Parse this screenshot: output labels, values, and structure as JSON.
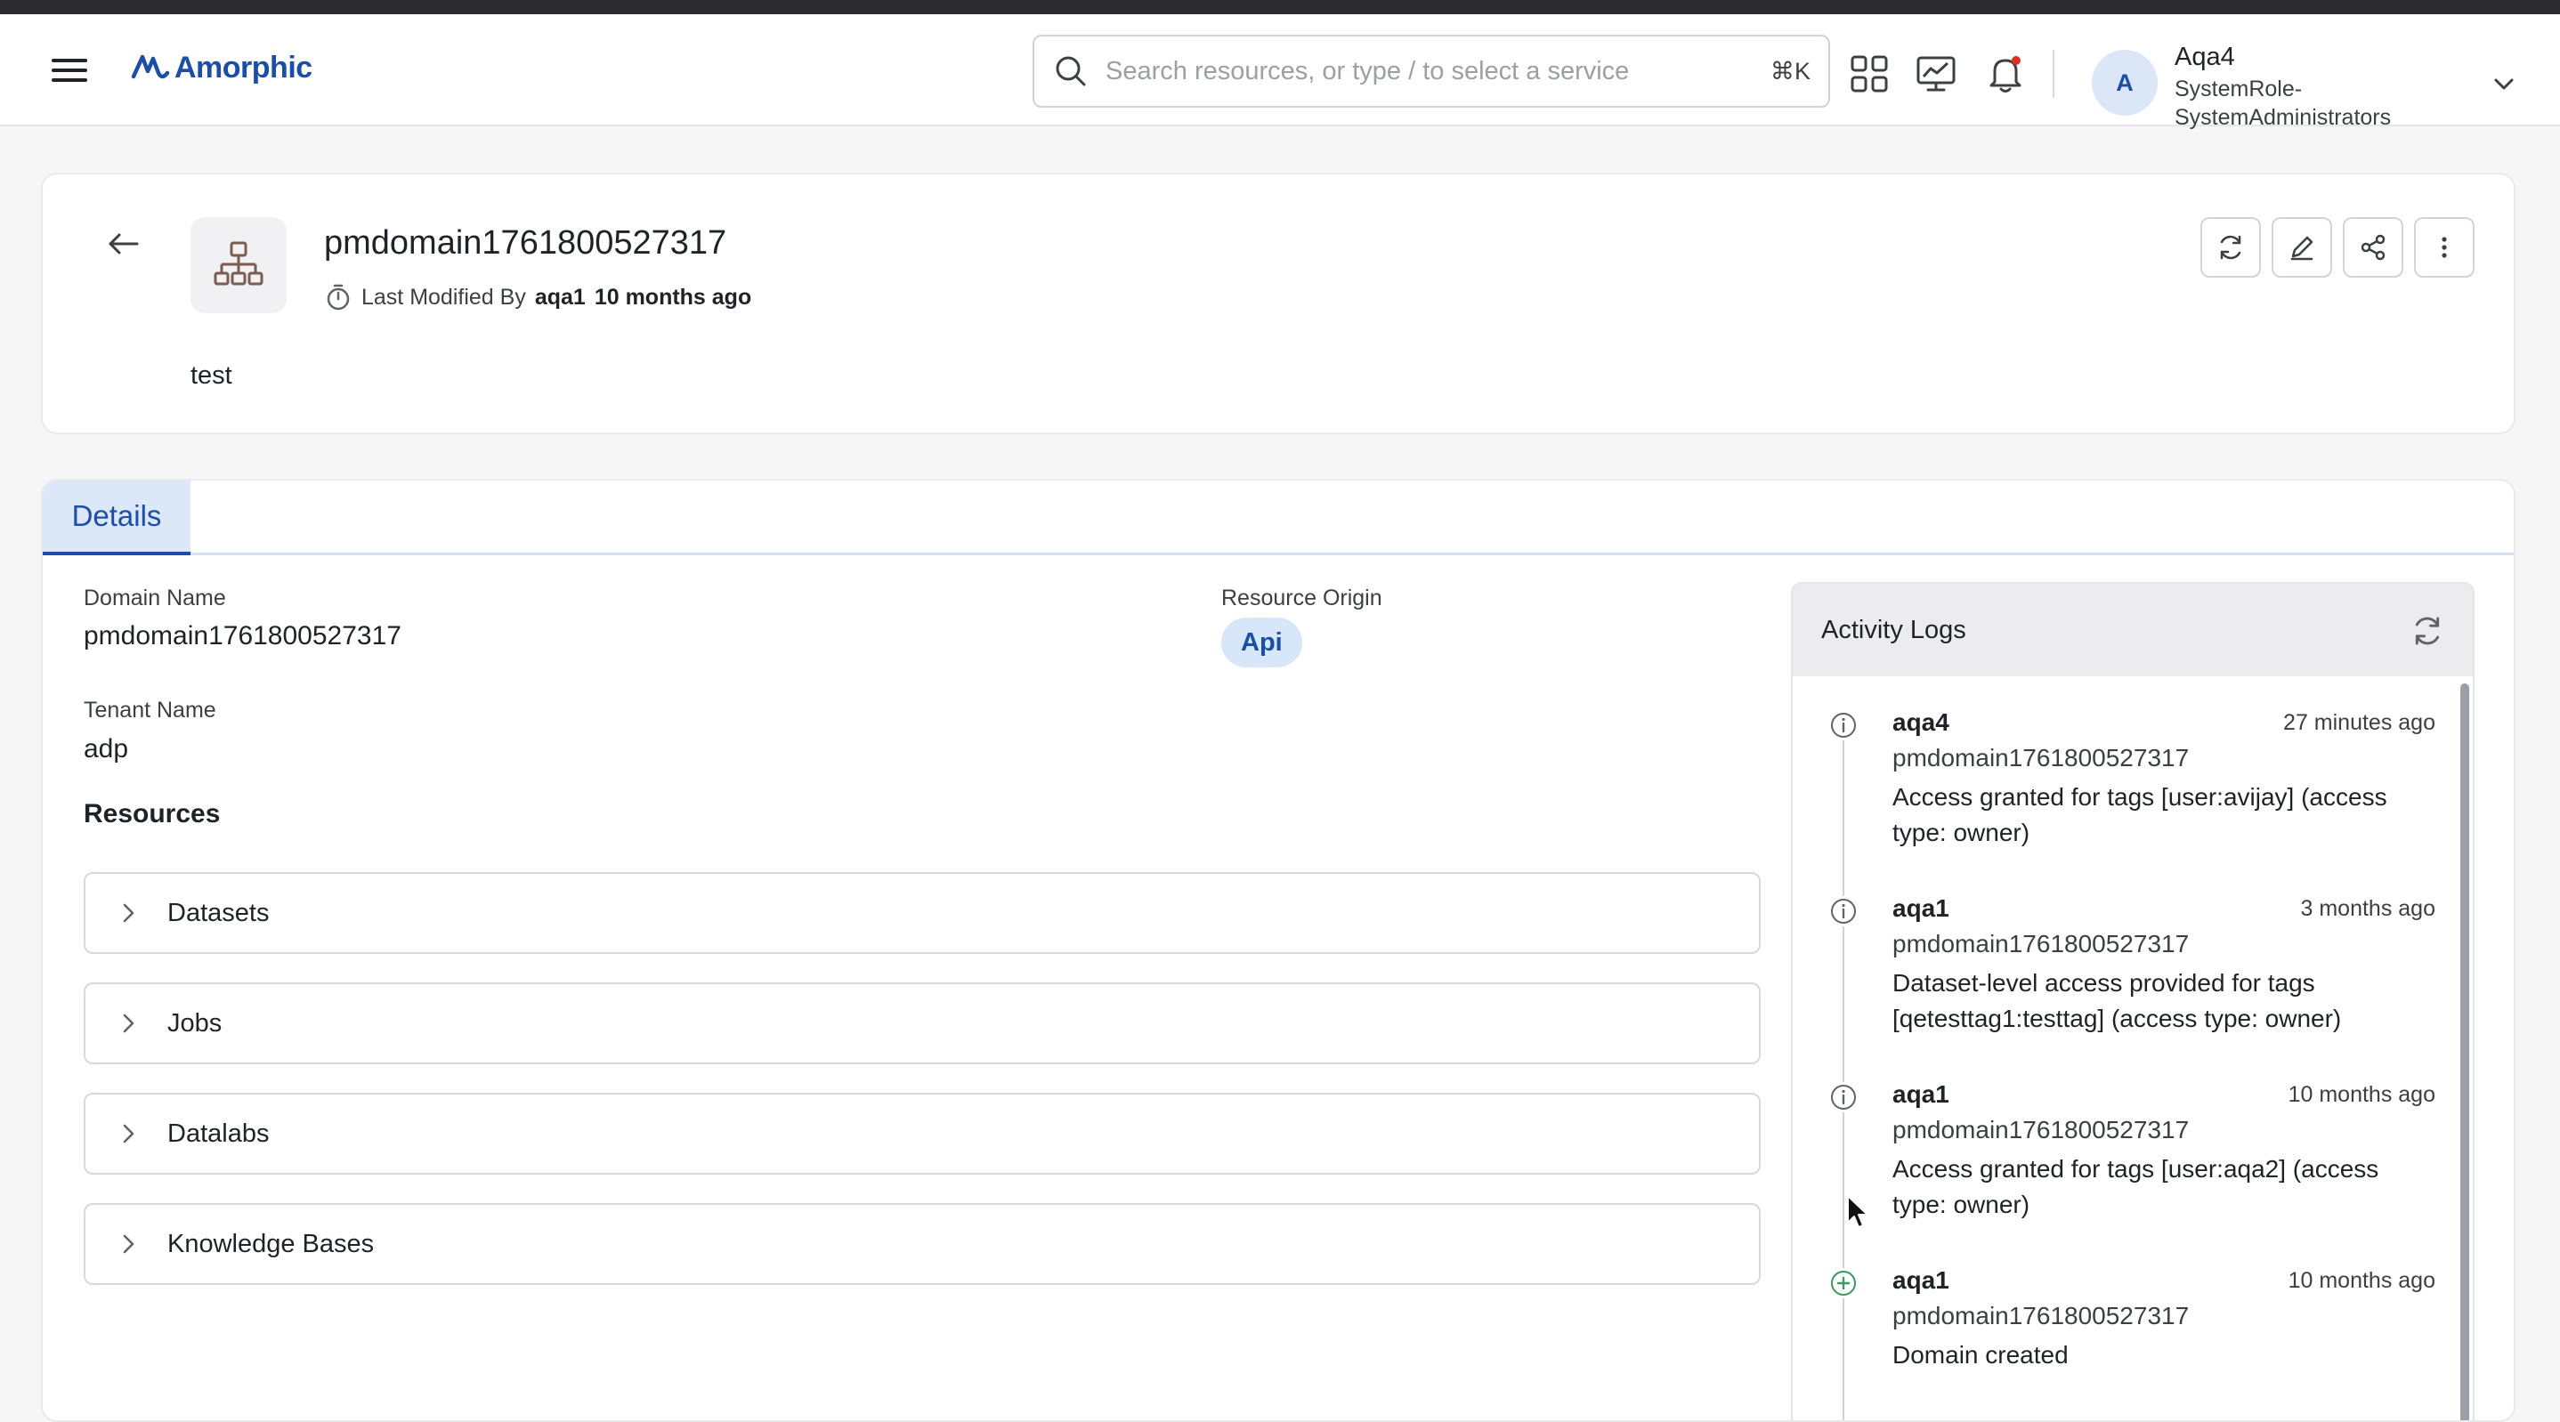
{
  "app": {
    "brand": "Amorphic",
    "accent_color": "#1a4ea8"
  },
  "search": {
    "placeholder": "Search resources, or type / to select a service",
    "shortcut": "⌘K",
    "icon": "search-icon"
  },
  "header_icons": [
    "apps-grid-icon",
    "monitor-chart-icon",
    "notification-bell-icon"
  ],
  "user": {
    "avatar_initial": "A",
    "name": "Aqa4",
    "role": "SystemRole-SystemAdministrators"
  },
  "domain": {
    "title": "pmdomain1761800527317",
    "modified_prefix": "Last Modified By",
    "modified_by": "aqa1",
    "modified_when": "10 months ago",
    "description": "test"
  },
  "actions": [
    "refresh-icon",
    "edit-icon",
    "share-icon",
    "more-vertical-icon"
  ],
  "tabs": [
    {
      "label": "Details",
      "active": true
    }
  ],
  "details": {
    "domain_name_label": "Domain Name",
    "domain_name": "pmdomain1761800527317",
    "resource_origin_label": "Resource Origin",
    "resource_origin": "Api",
    "tenant_name_label": "Tenant Name",
    "tenant_name": "adp",
    "resources_title": "Resources",
    "resources": [
      "Datasets",
      "Jobs",
      "Datalabs",
      "Knowledge Bases"
    ]
  },
  "activity": {
    "title": "Activity Logs",
    "logs": [
      {
        "user": "aqa4",
        "time": "27 minutes ago",
        "resource": "pmdomain1761800527317",
        "message": "Access granted for tags [user:avijay] (access type: owner)",
        "icon": "info-icon"
      },
      {
        "user": "aqa1",
        "time": "3 months ago",
        "resource": "pmdomain1761800527317",
        "message": "Dataset-level access provided for tags [qetesttag1:testtag] (access type: owner)",
        "icon": "info-icon"
      },
      {
        "user": "aqa1",
        "time": "10 months ago",
        "resource": "pmdomain1761800527317",
        "message": "Access granted for tags [user:aqa2] (access type: owner)",
        "icon": "info-icon"
      },
      {
        "user": "aqa1",
        "time": "10 months ago",
        "resource": "pmdomain1761800527317",
        "message": "Domain created",
        "icon": "plus-circle-icon"
      }
    ]
  }
}
